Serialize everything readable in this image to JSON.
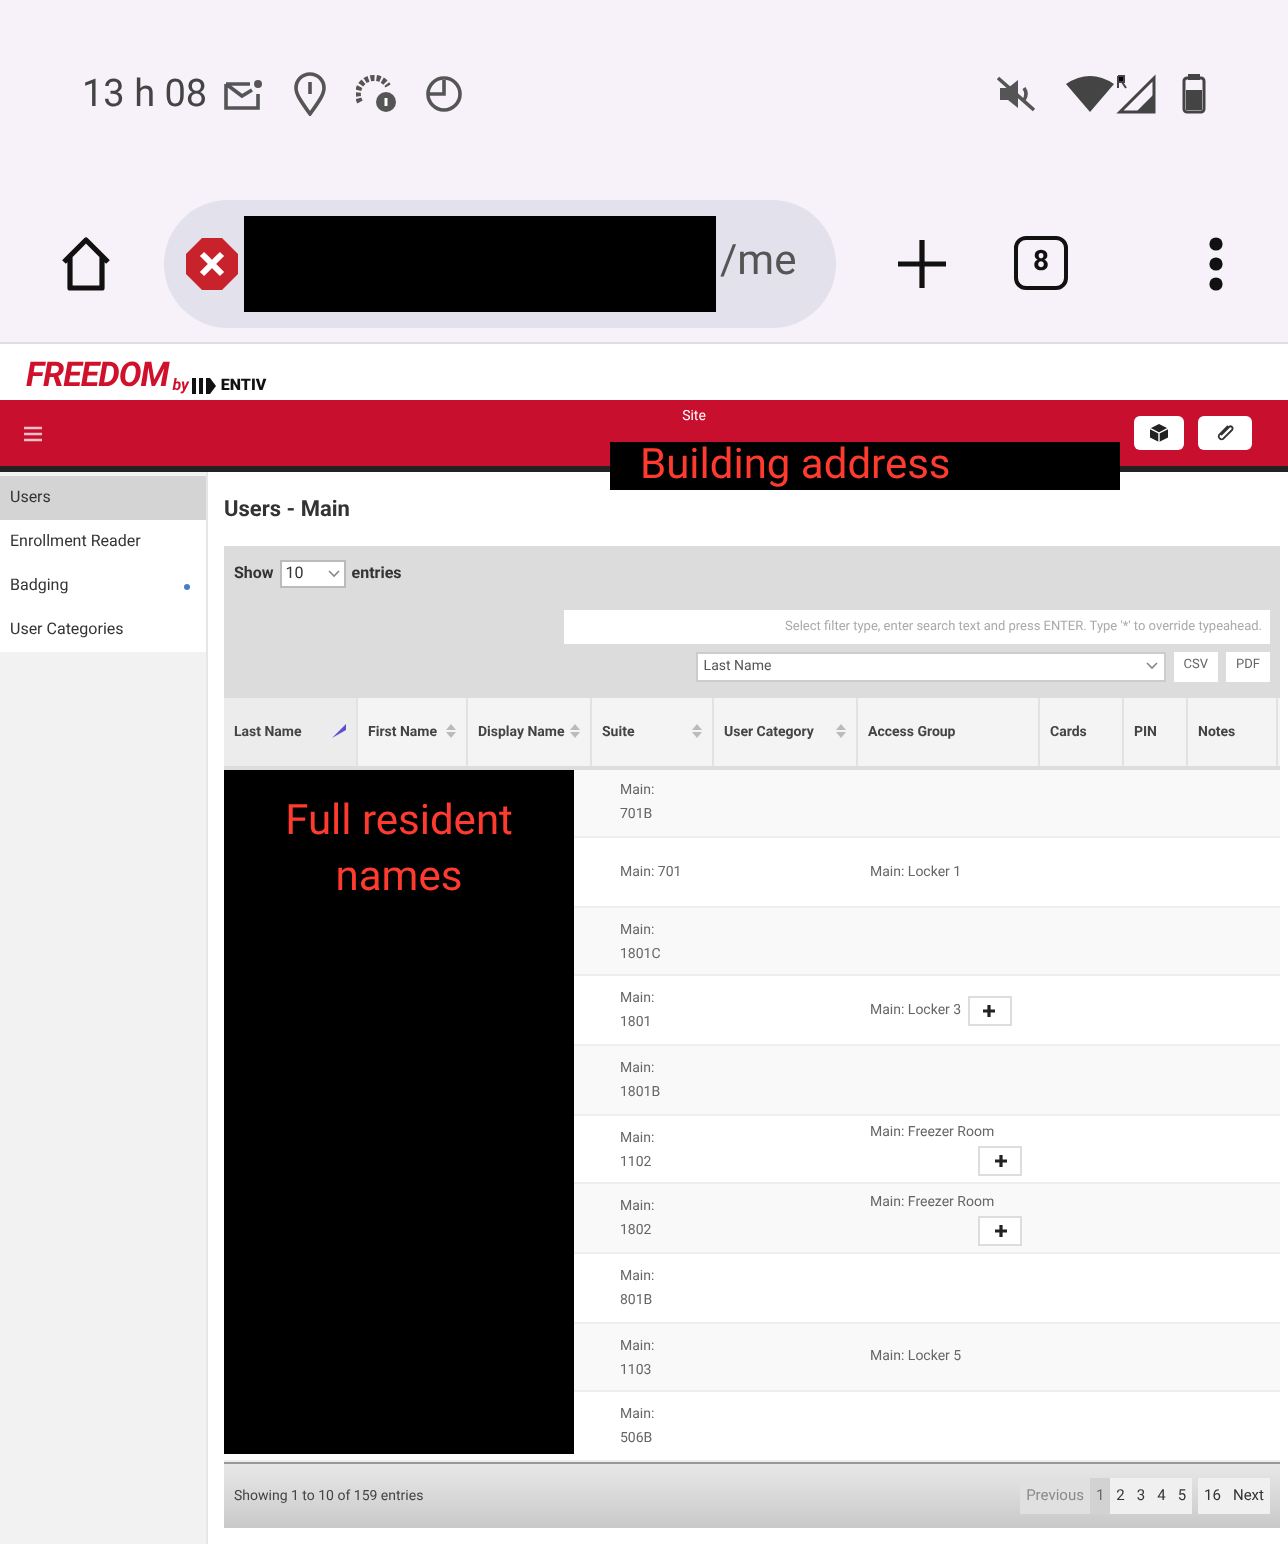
{
  "status_bar": {
    "time": "13 h 08"
  },
  "browser": {
    "url_tail": "/me",
    "tab_count": "8"
  },
  "app": {
    "brand": "FREEDOM",
    "by": "by",
    "maker": "ENTIV",
    "site_label": "Site",
    "site_annotation": "Building address"
  },
  "sidebar": {
    "items": [
      {
        "label": "Users",
        "selected": true,
        "has_dot": false
      },
      {
        "label": "Enrollment Reader",
        "selected": false,
        "has_dot": false
      },
      {
        "label": "Badging",
        "selected": false,
        "has_dot": true
      },
      {
        "label": "User Categories",
        "selected": false,
        "has_dot": false
      }
    ]
  },
  "page_title": "Users - Main",
  "length": {
    "show": "Show",
    "value": "10",
    "entries": "entries"
  },
  "filter": {
    "placeholder": "Select filter type, enter search text and press ENTER. Type '*' to override typeahead.",
    "filter_type": "Last Name",
    "buttons": [
      "CSV",
      "PDF"
    ]
  },
  "table": {
    "columns": [
      {
        "label": "Last Name",
        "kind": "sorted"
      },
      {
        "label": "First Name",
        "kind": "sortable"
      },
      {
        "label": "Display Name",
        "kind": "sortable"
      },
      {
        "label": "Suite",
        "kind": "sortable"
      },
      {
        "label": "User Category",
        "kind": "sortable"
      },
      {
        "label": "Access Group",
        "kind": "plain"
      },
      {
        "label": "Cards",
        "kind": "plain"
      },
      {
        "label": "PIN",
        "kind": "plain"
      },
      {
        "label": "Notes",
        "kind": "plain"
      }
    ],
    "names_annotation": "Full resident names",
    "rows": [
      {
        "suite": "Main: 701B",
        "add_button": false
      },
      {
        "suite": "Main: 701",
        "access_group": "Main: Locker 1",
        "add_button": false
      },
      {
        "suite": "Main: 1801C",
        "add_button": false
      },
      {
        "suite": "Main: 1801",
        "access_group": "Main: Locker 3",
        "add_button": true
      },
      {
        "suite": "Main: 1801B",
        "add_button": false
      },
      {
        "suite": "Main: 1102",
        "access_group": "Main: Freezer Room",
        "add_button": true
      },
      {
        "suite": "Main: 1802",
        "access_group": "Main: Freezer Room",
        "add_button": true
      },
      {
        "suite": "Main: 801B",
        "add_button": false
      },
      {
        "suite": "Main: 1103",
        "access_group": "Main: Locker 5",
        "add_button": false
      },
      {
        "suite": "Main: 506B",
        "add_button": false
      }
    ]
  },
  "footer": {
    "info": "Showing 1 to 10 of 159 entries",
    "pages": [
      {
        "label": "Previous",
        "selected": false,
        "disabled": true
      },
      {
        "label": "1",
        "selected": true,
        "disabled": false
      },
      {
        "label": "2",
        "selected": false,
        "disabled": false
      },
      {
        "label": "3",
        "selected": false,
        "disabled": false
      },
      {
        "label": "4",
        "selected": false,
        "disabled": false
      },
      {
        "label": "5",
        "selected": false,
        "disabled": false
      },
      {
        "label": "16",
        "selected": false,
        "disabled": false
      },
      {
        "label": "Next",
        "selected": false,
        "disabled": false
      }
    ]
  }
}
